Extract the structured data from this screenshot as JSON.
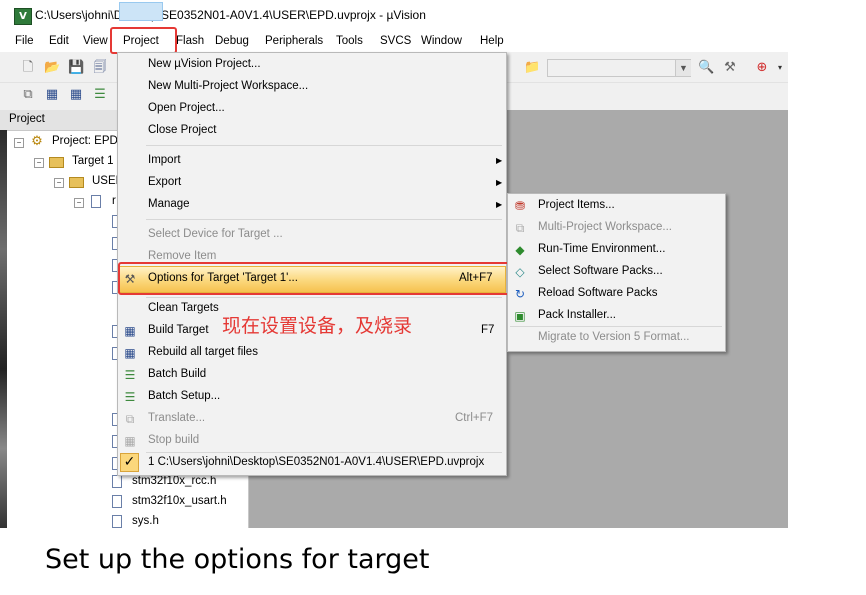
{
  "window": {
    "title": "C:\\Users\\johni\\Desktop\\SE0352N01-A0V1.4\\USER\\EPD.uvprojx - µVision",
    "app_icon_letter": "V"
  },
  "menubar": {
    "items": [
      "File",
      "Edit",
      "View",
      "Project",
      "Flash",
      "Debug",
      "Peripherals",
      "Tools",
      "SVCS",
      "Window",
      "Help"
    ]
  },
  "project_panel": {
    "header": "Project",
    "tree": [
      {
        "label": "Project: EPD"
      },
      {
        "label": "Target 1"
      },
      {
        "label": "USER"
      },
      {
        "label": "r"
      },
      {
        "label": "stm32f10x_rcc.h"
      },
      {
        "label": "stm32f10x_usart.h"
      },
      {
        "label": "sys.h"
      }
    ]
  },
  "project_menu": {
    "items": [
      {
        "label": "New µVision Project..."
      },
      {
        "label": "New Multi-Project Workspace..."
      },
      {
        "label": "Open Project..."
      },
      {
        "label": "Close Project"
      },
      {
        "label": "Import"
      },
      {
        "label": "Export"
      },
      {
        "label": "Manage"
      },
      {
        "label": "Select Device for Target ..."
      },
      {
        "label": "Remove Item"
      },
      {
        "label": "Options for Target 'Target 1'...",
        "shortcut": "Alt+F7"
      },
      {
        "label": "Clean Targets"
      },
      {
        "label": "Build Target",
        "shortcut": "F7"
      },
      {
        "label": "Rebuild all target files"
      },
      {
        "label": "Batch Build"
      },
      {
        "label": "Batch Setup..."
      },
      {
        "label": "Translate...",
        "shortcut": "Ctrl+F7"
      },
      {
        "label": "Stop build"
      },
      {
        "label": "1 C:\\Users\\johni\\Desktop\\SE0352N01-A0V1.4\\USER\\EPD.uvprojx"
      }
    ]
  },
  "manage_submenu": {
    "items": [
      {
        "label": "Project Items..."
      },
      {
        "label": "Multi-Project Workspace..."
      },
      {
        "label": "Run-Time Environment..."
      },
      {
        "label": "Select Software Packs..."
      },
      {
        "label": "Reload Software Packs"
      },
      {
        "label": "Pack Installer..."
      },
      {
        "label": "Migrate to Version 5 Format..."
      }
    ]
  },
  "annotation": {
    "text": "现在设置设备，及烧录",
    "color": "#e53935"
  },
  "caption": {
    "text": "Set up the options for target"
  },
  "colors": {
    "highlight": "#fbd77c",
    "annotation_box": "#e53935",
    "editor_bg": "#aaaaaa"
  }
}
